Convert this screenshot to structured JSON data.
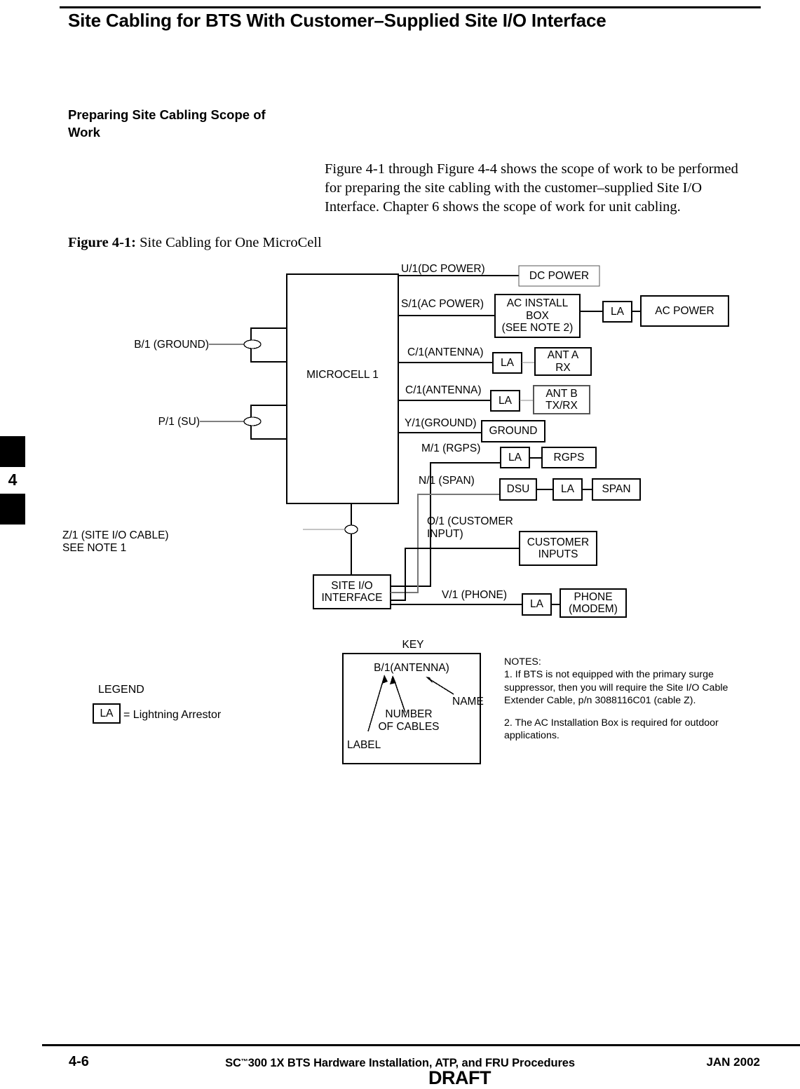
{
  "page": {
    "title": "Site Cabling for BTS With Customer–Supplied Site I/O Interface",
    "section_heading": "Preparing Site Cabling Scope\nof Work",
    "body_paragraph": "Figure 4-1 through Figure 4-4 shows the scope of work to be performed for preparing the site cabling with the customer–supplied Site I/O Interface.  Chapter 6 shows the scope of work for unit cabling.",
    "tab_number": "4"
  },
  "figure": {
    "caption_label": "Figure 4-1:",
    "caption_text": " Site Cabling for One MicroCell"
  },
  "diagram": {
    "main_unit": "MICROCELL 1",
    "site_io": "SITE I/O\nINTERFACE",
    "left_ports": [
      {
        "label": "B/1 (GROUND)"
      },
      {
        "label": "P/1 (SU)"
      }
    ],
    "cable_z": "Z/1 (SITE I/O CABLE)\nSEE NOTE 1",
    "rows": [
      {
        "cable": "U/1(DC POWER)",
        "boxes": [
          {
            "text": "DC POWER"
          }
        ]
      },
      {
        "cable": "S/1(AC POWER)",
        "boxes": [
          {
            "text": "AC INSTALL\nBOX\n(SEE NOTE 2)"
          },
          {
            "text": "LA"
          },
          {
            "text": "AC POWER"
          }
        ]
      },
      {
        "cable": "C/1(ANTENNA)",
        "boxes": [
          {
            "text": "LA"
          },
          {
            "text": "ANT A\nRX"
          }
        ]
      },
      {
        "cable": "C/1(ANTENNA)",
        "boxes": [
          {
            "text": "LA"
          },
          {
            "text": "ANT B\nTX/RX"
          }
        ]
      },
      {
        "cable": "Y/1(GROUND)",
        "boxes": [
          {
            "text": "GROUND"
          }
        ]
      },
      {
        "cable": "M/1 (RGPS)",
        "boxes": [
          {
            "text": "LA"
          },
          {
            "text": "RGPS"
          }
        ]
      },
      {
        "cable": "N/1 (SPAN)",
        "boxes": [
          {
            "text": "DSU"
          },
          {
            "text": "LA"
          },
          {
            "text": "SPAN"
          }
        ]
      },
      {
        "cable": "O/1 (CUSTOMER\nINPUT)",
        "boxes": [
          {
            "text": "CUSTOMER\nINPUTS"
          }
        ]
      },
      {
        "cable": "V/1 (PHONE)",
        "boxes": [
          {
            "text": "LA"
          },
          {
            "text": "PHONE\n(MODEM)"
          }
        ]
      }
    ]
  },
  "legend": {
    "title": "LEGEND",
    "symbol": "LA",
    "description": "= Lightning  Arrestor"
  },
  "key": {
    "title": "KEY",
    "sample": "B/1(ANTENNA)",
    "callout_name": "NAME",
    "callout_number": "NUMBER\nOF CABLES",
    "callout_label": "LABEL"
  },
  "notes": {
    "title": "NOTES:",
    "items": [
      "1.  If BTS is not equipped with the primary surge suppressor, then you will require the Site I/O Cable Extender Cable, p/n 3088116C01 (cable Z).",
      "2.  The AC Installation Box is required for outdoor applications."
    ]
  },
  "footer": {
    "page_number": "4-6",
    "doc_prefix": "SC",
    "doc_tm": "™",
    "doc_title": "300 1X BTS Hardware Installation, ATP, and FRU Procedures",
    "date": "JAN 2002",
    "draft": "DRAFT"
  }
}
